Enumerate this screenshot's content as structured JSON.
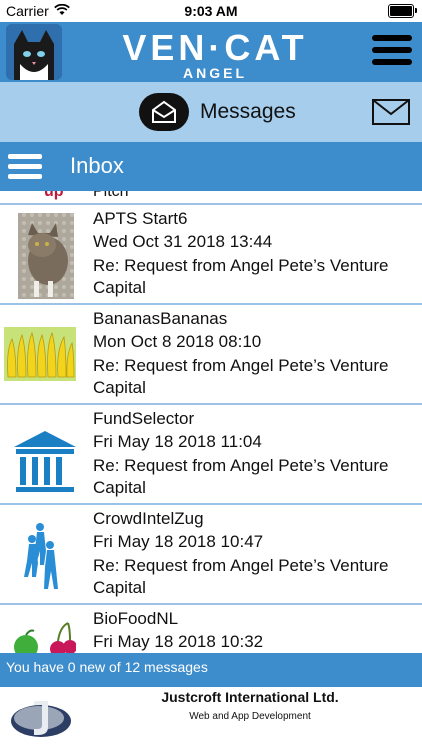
{
  "status_bar": {
    "carrier": "Carrier",
    "time": "9:03 AM"
  },
  "brand": {
    "wordmark": "VEN·CAT",
    "subword": "ANGEL"
  },
  "message_bar": {
    "label": "Messages"
  },
  "inbox_bar": {
    "title": "Inbox"
  },
  "partial_row": {
    "thumb_text": "up",
    "text": "Pitch"
  },
  "messages": [
    {
      "name": "APTS Start6",
      "date": "Wed Oct 31 2018 13:44",
      "subject": "Re: Request from Angel Pete’s Venture Capital",
      "thumb": "cat-photo"
    },
    {
      "name": "BananasBananas",
      "date": "Mon Oct 8 2018 08:10",
      "subject": "Re: Request from Angel Pete’s Venture Capital",
      "thumb": "bananas-photo"
    },
    {
      "name": "FundSelector",
      "date": "Fri May 18 2018 11:04",
      "subject": "Re: Request from Angel Pete’s Venture Capital",
      "thumb": "bank-icon"
    },
    {
      "name": "CrowdIntelZug",
      "date": "Fri May 18 2018 10:47",
      "subject": "Re: Request from Angel Pete’s Venture Capital",
      "thumb": "crowd-icon"
    },
    {
      "name": "BioFoodNL",
      "date": "Fri May 18 2018 10:32",
      "subject": "",
      "thumb": "fruit-icon"
    }
  ],
  "footer_status": {
    "text": "You have 0 new of 12 messages"
  },
  "credit": {
    "company": "Justcroft International Ltd.",
    "tagline": "Web and App Development"
  },
  "colors": {
    "brand_blue": "#3d8ccb",
    "light_blue": "#a6cdec",
    "divider": "#9cc3e6"
  }
}
